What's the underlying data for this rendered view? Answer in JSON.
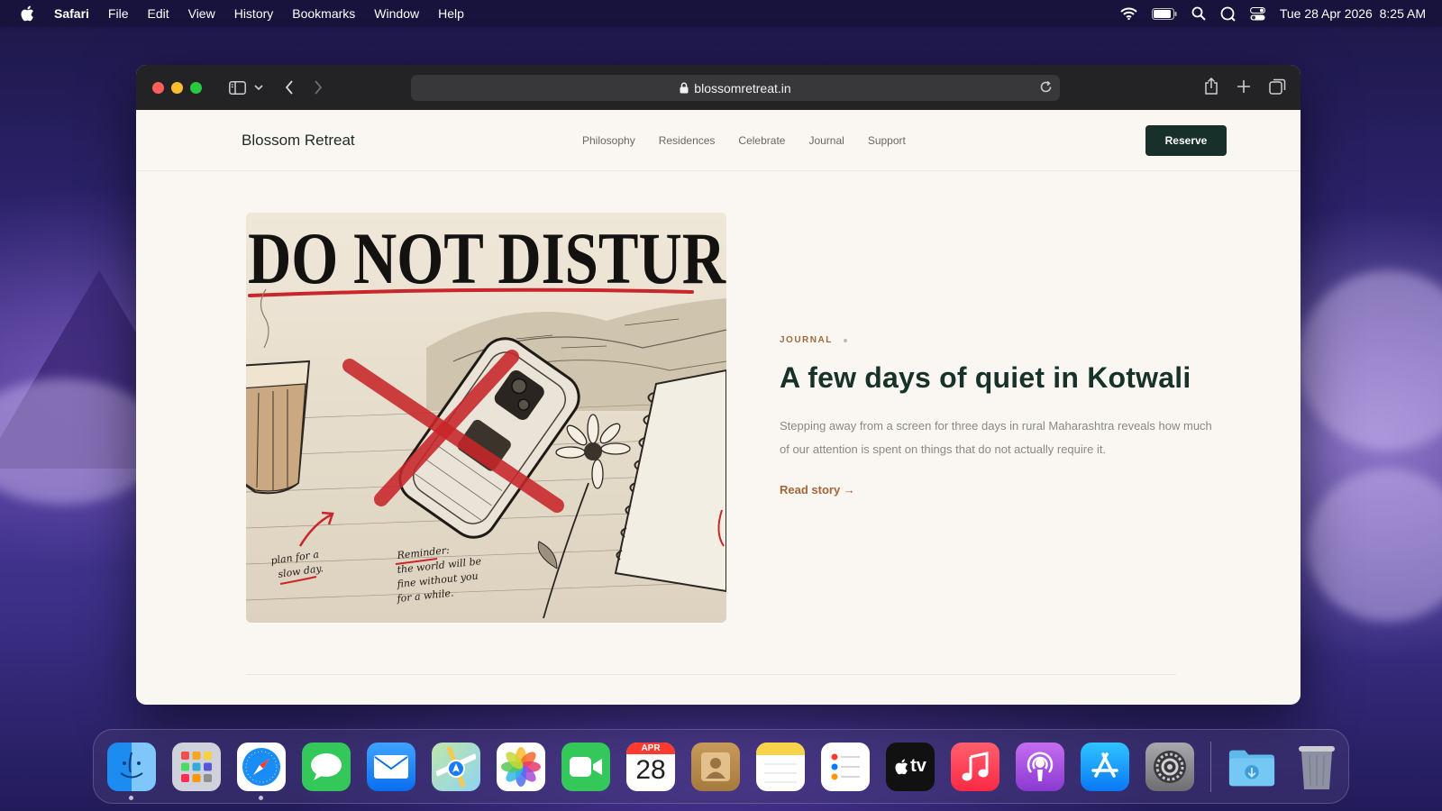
{
  "menubar": {
    "app_name": "Safari",
    "items": [
      "File",
      "Edit",
      "View",
      "History",
      "Bookmarks",
      "Window",
      "Help"
    ],
    "datetime": "Tue 28 Apr 2026  8:25 AM"
  },
  "browser": {
    "url": "blossomretreat.in"
  },
  "site": {
    "brand": "Blossom Retreat",
    "nav": [
      "Philosophy",
      "Residences",
      "Celebrate",
      "Journal",
      "Support"
    ],
    "reserve_label": "Reserve"
  },
  "hero": {
    "image_text": {
      "headline": "DO NOT DISTUR",
      "note_left": [
        "plan for a",
        "slow day."
      ],
      "note_right": [
        "Reminder:",
        "the world will be",
        "fine without you",
        "for a while."
      ]
    },
    "kicker": "JOURNAL",
    "title": "A few days of quiet in Kotwali",
    "summary": "Stepping away from a screen for three days in rural Maharashtra reveals how much of our attention is spent on things that do not actually require it.",
    "read_more": "Read story →"
  },
  "dock": {
    "calendar_month": "APR",
    "calendar_day": "28",
    "tv_label": "tv",
    "items": [
      "finder-icon",
      "launchpad-icon",
      "safari-icon",
      "messages-icon",
      "mail-icon",
      "maps-icon",
      "photos-icon",
      "facetime-icon",
      "calendar-icon",
      "contacts-icon",
      "notes-icon",
      "reminders-icon",
      "tv-icon",
      "music-icon",
      "podcasts-icon",
      "app-store-icon",
      "system-settings-icon",
      "downloads-folder-icon",
      "trash-icon"
    ]
  },
  "colors": {
    "accent_dark_green": "#17302a",
    "accent_copper": "#a5653a"
  }
}
